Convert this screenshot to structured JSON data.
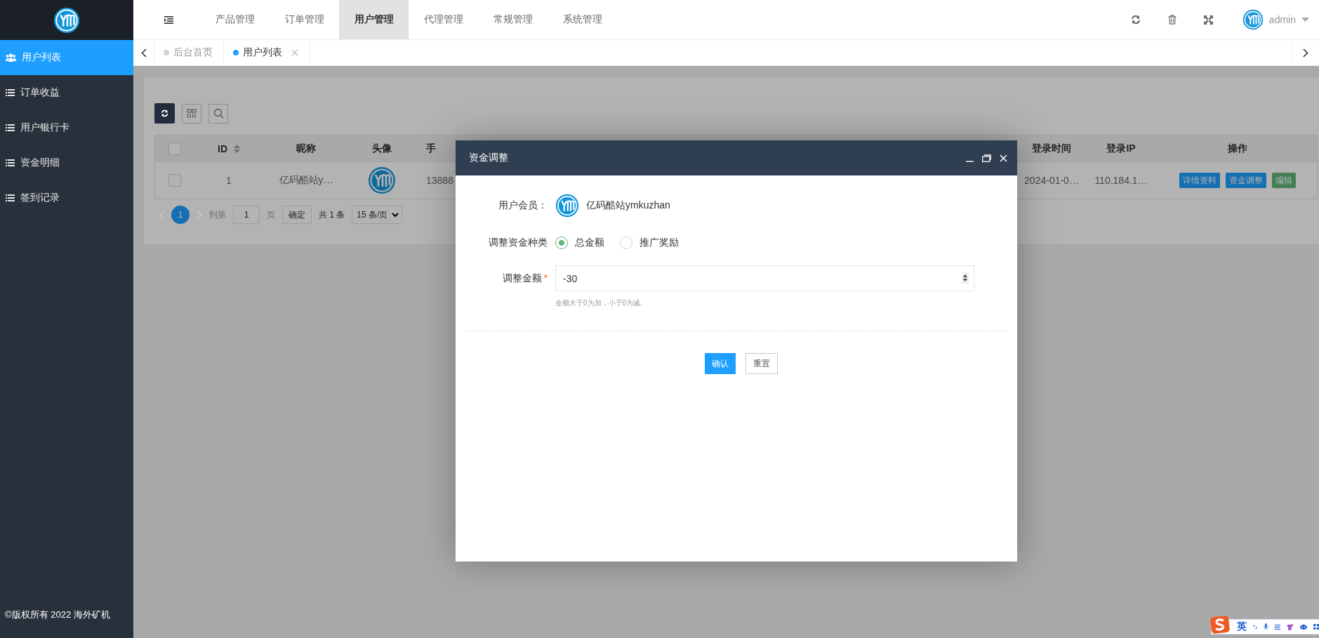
{
  "sidebar": {
    "items": [
      {
        "label": "用户列表",
        "selected": true
      },
      {
        "label": "订单收益",
        "selected": false
      },
      {
        "label": "用户银行卡",
        "selected": false
      },
      {
        "label": "资金明细",
        "selected": false
      },
      {
        "label": "签到记录",
        "selected": false
      }
    ],
    "footer": "©版权所有 2022 海外矿机"
  },
  "top_nav": {
    "items": [
      {
        "label": "产品管理",
        "selected": false
      },
      {
        "label": "订单管理",
        "selected": false
      },
      {
        "label": "用户管理",
        "selected": true
      },
      {
        "label": "代理管理",
        "selected": false
      },
      {
        "label": "常规管理",
        "selected": false
      },
      {
        "label": "系统管理",
        "selected": false
      }
    ],
    "user": "admin"
  },
  "tabs": [
    {
      "label": "后台首页",
      "selected": false
    },
    {
      "label": "用户列表",
      "selected": true
    }
  ],
  "table": {
    "select_all": false,
    "columns": [
      "ID",
      "昵称",
      "头像",
      "手",
      "登录时间",
      "登录IP",
      "操作"
    ],
    "rows": [
      {
        "checked": false,
        "id": "1",
        "nickname": "亿码酷站y…",
        "phone": "13888",
        "login_time": "2024-01-0…",
        "login_ip": "110.184.1…",
        "actions": [
          {
            "label": "详情资料",
            "color": "#156fb3"
          },
          {
            "label": "资金调整",
            "color": "#156fb3"
          },
          {
            "label": "编辑",
            "color": "#438154"
          }
        ]
      }
    ]
  },
  "pagination": {
    "pages": [
      {
        "label": "1",
        "selected": true
      }
    ],
    "goto": "到第",
    "page_input": "1",
    "page_unit": "页",
    "confirm": "确定",
    "total": "共 1 条",
    "page_size": "15 条/页"
  },
  "dialog": {
    "title": "资金调整",
    "member_label": "用户会员：",
    "member_name": "亿码酷站ymkuzhan",
    "type_label": "调整资金种类",
    "types": [
      {
        "label": "总金额",
        "selected": true
      },
      {
        "label": "推广奖励",
        "selected": false
      }
    ],
    "amount_label": "调整金额",
    "required_mark": "*",
    "amount_value": "-30",
    "hint": "金额大于0为加，小于0为减。",
    "buttons": [
      {
        "label": "确认",
        "kind": "primary"
      },
      {
        "label": "重置",
        "kind": "default"
      }
    ]
  },
  "ime": {
    "language": "英"
  }
}
